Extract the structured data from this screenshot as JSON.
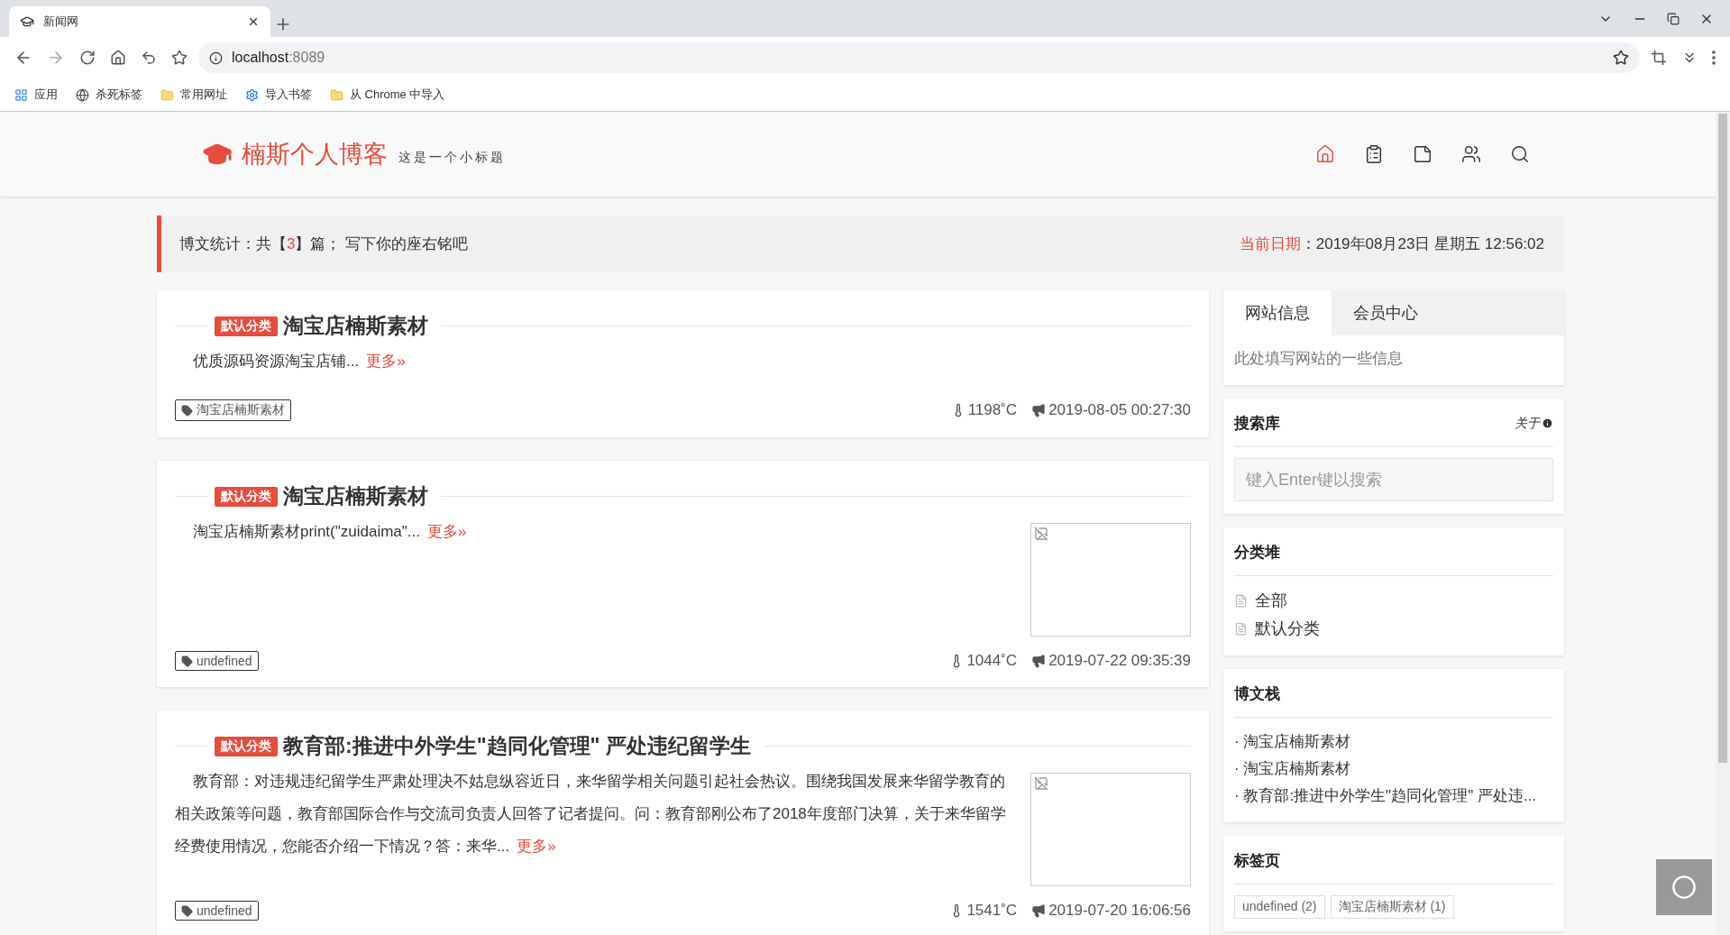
{
  "browser": {
    "tab_title": "新闻网",
    "url_host": "localhost",
    "url_port": ":8089",
    "bookmarks": [
      {
        "kind": "apps",
        "label": "应用"
      },
      {
        "kind": "globe",
        "label": "杀死标签"
      },
      {
        "kind": "folder",
        "label": "常用网址"
      },
      {
        "kind": "gear",
        "label": "导入书签"
      },
      {
        "kind": "folder",
        "label": "从 Chrome 中导入"
      }
    ]
  },
  "header": {
    "title": "楠斯个人博客",
    "subtitle": "这是一个小标题",
    "nav": [
      {
        "kind": "home",
        "selected": true
      },
      {
        "kind": "clipboard",
        "selected": false
      },
      {
        "kind": "note",
        "selected": false
      },
      {
        "kind": "users",
        "selected": false
      },
      {
        "kind": "search",
        "selected": false
      }
    ]
  },
  "stats": {
    "prefix": "博文统计：共【",
    "count": "3",
    "suffix": "】篇； 写下你的座右铭吧",
    "date_label": "当前日期",
    "date_value": "：2019年08月23日 星期五 12:56:02"
  },
  "posts": [
    {
      "category": "默认分类",
      "title": "淘宝店楠斯素材",
      "excerpt": "优质源码资源淘宝店铺...",
      "more": "更多»",
      "tag": "淘宝店楠斯素材",
      "heat": "1198˚C",
      "time": "2019-08-05 00:27:30",
      "thumbnail": false
    },
    {
      "category": "默认分类",
      "title": "淘宝店楠斯素材",
      "excerpt": "淘宝店楠斯素材print(\"zuidaima\"...",
      "more": "更多»",
      "tag": "undefined",
      "heat": "1044˚C",
      "time": "2019-07-22 09:35:39",
      "thumbnail": true
    },
    {
      "category": "默认分类",
      "title": "教育部:推进中外学生\"趋同化管理\" 严处违纪留学生",
      "excerpt": "教育部：对违规违纪留学生严肃处理决不姑息纵容近日，来华留学相关问题引起社会热议。围绕我国发展来华留学教育的相关政策等问题，教育部国际合作与交流司负责人回答了记者提问。问：教育部刚公布了2018年度部门决算，关于来华留学经费使用情况，您能否介绍一下情况？答：来华...",
      "more": "更多»",
      "tag": "undefined",
      "heat": "1541˚C",
      "time": "2019-07-20 16:06:56",
      "thumbnail": true
    }
  ],
  "sidebar": {
    "tabs": [
      {
        "label": "网站信息",
        "selected": true
      },
      {
        "label": "会员中心",
        "selected": false
      }
    ],
    "info": "此处填写网站的一些信息",
    "search": {
      "title": "搜索库",
      "about": "关于",
      "placeholder": "键入Enter键以搜索"
    },
    "categories": {
      "title": "分类堆",
      "items": [
        "全部",
        "默认分类"
      ]
    },
    "recent": {
      "title": "博文栈",
      "items": [
        "· 淘宝店楠斯素材",
        "· 淘宝店楠斯素材",
        "· 教育部:推进中外学生\"趋同化管理\" 严处违..."
      ]
    },
    "tags": {
      "title": "标签页",
      "items": [
        "undefined (2)",
        "淘宝店楠斯素材 (1)"
      ]
    }
  }
}
